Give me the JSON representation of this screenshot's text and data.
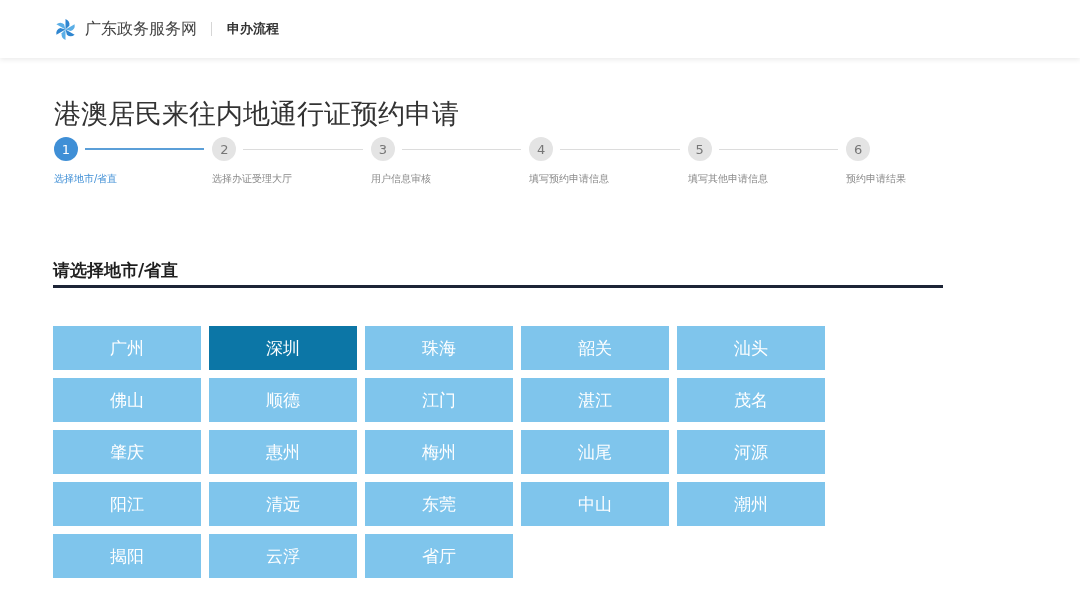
{
  "header": {
    "site_name": "广东政务服务网",
    "section": "申办流程"
  },
  "page_title": "港澳居民来往内地通行证预约申请",
  "steps": [
    {
      "number": "1",
      "label": "选择地市/省直",
      "selected": true
    },
    {
      "number": "2",
      "label": "选择办证受理大厅",
      "selected": false
    },
    {
      "number": "3",
      "label": "用户信息审核",
      "selected": false
    },
    {
      "number": "4",
      "label": "填写预约申请信息",
      "selected": false
    },
    {
      "number": "5",
      "label": "填写其他申请信息",
      "selected": false
    },
    {
      "number": "6",
      "label": "预约申请结果",
      "selected": false
    }
  ],
  "city_section": {
    "heading": "请选择地市/省直",
    "cities": [
      {
        "label": "广州",
        "selected": false
      },
      {
        "label": "深圳",
        "selected": true
      },
      {
        "label": "珠海",
        "selected": false
      },
      {
        "label": "韶关",
        "selected": false
      },
      {
        "label": "汕头",
        "selected": false
      },
      {
        "label": "佛山",
        "selected": false
      },
      {
        "label": "顺德",
        "selected": false
      },
      {
        "label": "江门",
        "selected": false
      },
      {
        "label": "湛江",
        "selected": false
      },
      {
        "label": "茂名",
        "selected": false
      },
      {
        "label": "肇庆",
        "selected": false
      },
      {
        "label": "惠州",
        "selected": false
      },
      {
        "label": "梅州",
        "selected": false
      },
      {
        "label": "汕尾",
        "selected": false
      },
      {
        "label": "河源",
        "selected": false
      },
      {
        "label": "阳江",
        "selected": false
      },
      {
        "label": "清远",
        "selected": false
      },
      {
        "label": "东莞",
        "selected": false
      },
      {
        "label": "中山",
        "selected": false
      },
      {
        "label": "潮州",
        "selected": false
      },
      {
        "label": "揭阳",
        "selected": false
      },
      {
        "label": "云浮",
        "selected": false
      },
      {
        "label": "省厅",
        "selected": false
      }
    ]
  }
}
